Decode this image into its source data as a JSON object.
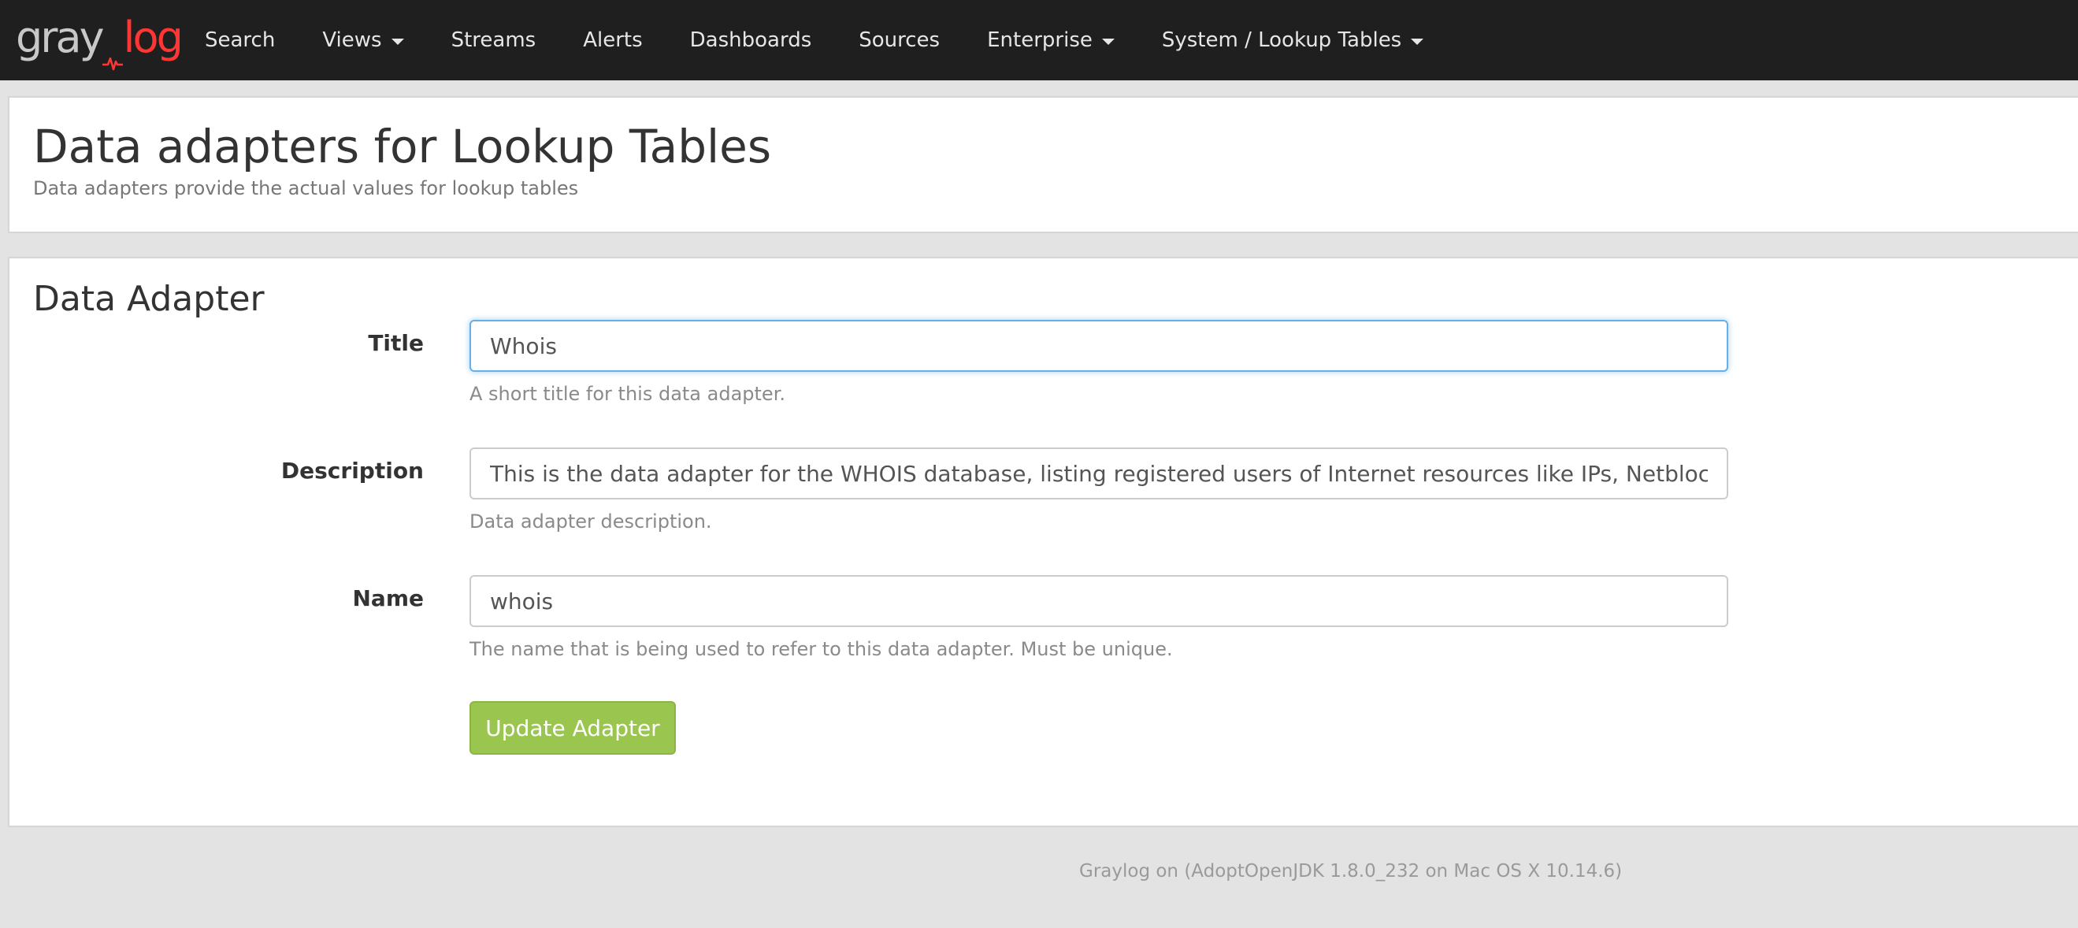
{
  "brand": {
    "logo_part1": "gray",
    "logo_part2": "log",
    "logo_icon": "pulse-icon",
    "colors": {
      "navbar_bg": "#1f1f1f",
      "logo_gray": "#c8c8c8",
      "logo_red": "#ff3633",
      "primary_button": "#9ac64f",
      "focus_border": "#66afe9"
    }
  },
  "navbar": {
    "items": [
      {
        "label": "Search",
        "dropdown": false
      },
      {
        "label": "Views",
        "dropdown": true
      },
      {
        "label": "Streams",
        "dropdown": false
      },
      {
        "label": "Alerts",
        "dropdown": false
      },
      {
        "label": "Dashboards",
        "dropdown": false
      },
      {
        "label": "Sources",
        "dropdown": false
      },
      {
        "label": "Enterprise",
        "dropdown": true
      },
      {
        "label": "System / Lookup Tables",
        "dropdown": true
      }
    ]
  },
  "header": {
    "title": "Data adapters for Lookup Tables",
    "subtitle": "Data adapters provide the actual values for lookup tables"
  },
  "form": {
    "section_title": "Data Adapter",
    "fields": {
      "title": {
        "label": "Title",
        "value": "Whois",
        "help": "A short title for this data adapter."
      },
      "description": {
        "label": "Description",
        "value": "This is the data adapter for the WHOIS database, listing registered users of Internet resources like IPs, Netblocks or Domains",
        "help": "Data adapter description."
      },
      "name": {
        "label": "Name",
        "value": "whois",
        "help": "The name that is being used to refer to this data adapter. Must be unique."
      }
    },
    "submit_label": "Update Adapter"
  },
  "footer": {
    "text": "Graylog on (AdoptOpenJDK 1.8.0_232 on Mac OS X 10.14.6)"
  }
}
